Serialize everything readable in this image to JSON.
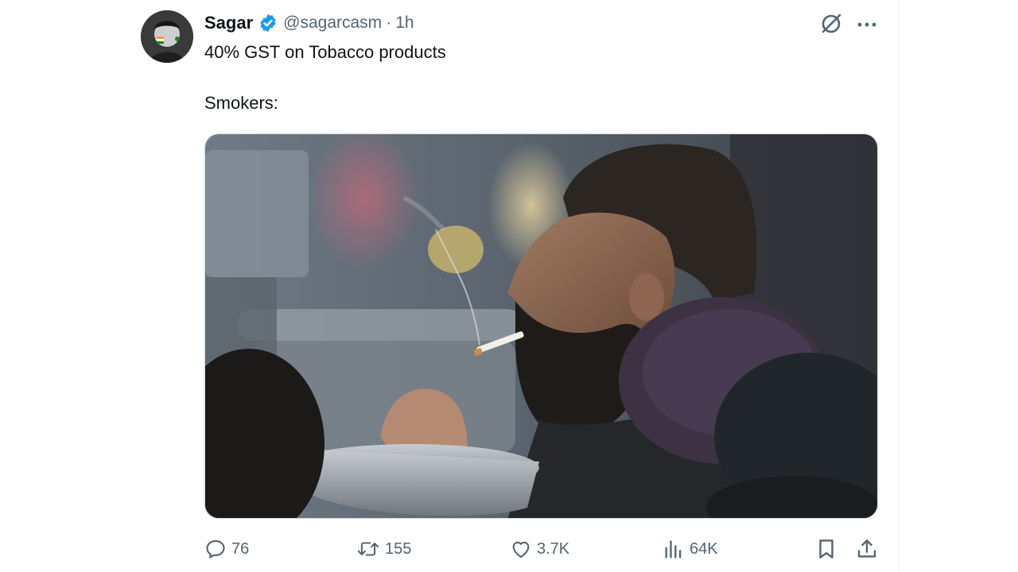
{
  "author": {
    "name": "Sagar",
    "handle": "@sagarcasm",
    "separator": "·",
    "time": "1h",
    "verified": true
  },
  "tweet": {
    "line1": "40% GST on Tobacco products",
    "line2": "Smokers:"
  },
  "media": {
    "type": "photo",
    "description_icon": "photo-image"
  },
  "actions": {
    "reply": {
      "icon": "reply-icon",
      "count": "76"
    },
    "retweet": {
      "icon": "retweet-icon",
      "count": "155"
    },
    "like": {
      "icon": "heart-icon",
      "count": "3.7K"
    },
    "views": {
      "icon": "views-icon",
      "count": "64K"
    },
    "bookmark": {
      "icon": "bookmark-icon"
    },
    "share": {
      "icon": "share-icon"
    }
  },
  "colors": {
    "text": "#0f1419",
    "muted": "#536471",
    "verified": "#1d9bf0",
    "border": "#eff3f4"
  }
}
